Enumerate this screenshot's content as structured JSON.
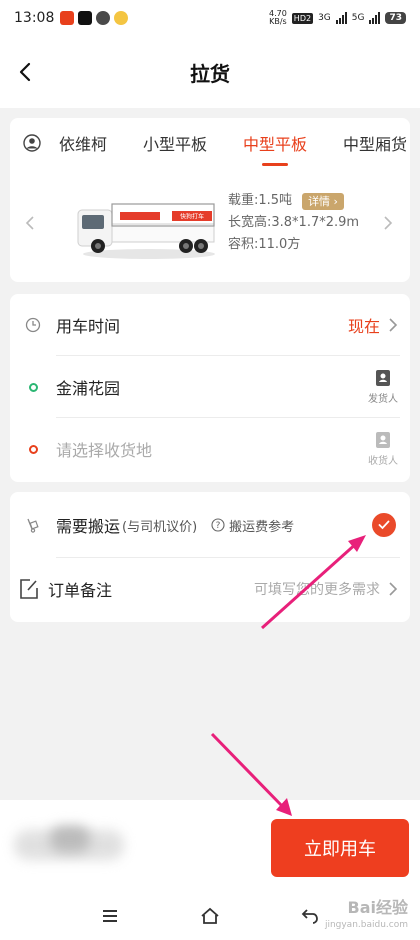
{
  "status": {
    "time": "13:08",
    "net_speed": "4.70\nKB/s",
    "hd": "HD2",
    "sig1": "3G",
    "sig2": "5G",
    "battery": "73"
  },
  "header": {
    "title": "拉货"
  },
  "tabs": [
    {
      "label": "依维柯",
      "active": false
    },
    {
      "label": "小型平板",
      "active": false
    },
    {
      "label": "中型平板",
      "active": true
    },
    {
      "label": "中型厢货",
      "active": false
    }
  ],
  "vehicle": {
    "load": "载重:1.5吨",
    "detail_label": "详情",
    "dims": "长宽高:3.8*1.7*2.9m",
    "volume": "容积:11.0方",
    "truck_banner": "快狗打车"
  },
  "form": {
    "time_label": "用车时间",
    "time_value": "现在",
    "origin": "金浦花园",
    "sender_label": "发货人",
    "dest_placeholder": "请选择收货地",
    "receiver_label": "收货人"
  },
  "options": {
    "carry_label": "需要搬运",
    "carry_sub": "(与司机议价)",
    "fee_ref": "搬运费参考",
    "carry_checked": true,
    "remark_label": "订单备注",
    "remark_placeholder": "可填写您的更多需求"
  },
  "footer": {
    "cta": "立即用车"
  },
  "watermark": {
    "main": "Bai经验",
    "sub": "jingyan.baidu.com"
  },
  "colors": {
    "accent": "#ee3e1f",
    "badge": "#caa66c",
    "green_dot": "#2bb673",
    "red_dot": "#e8401c"
  }
}
